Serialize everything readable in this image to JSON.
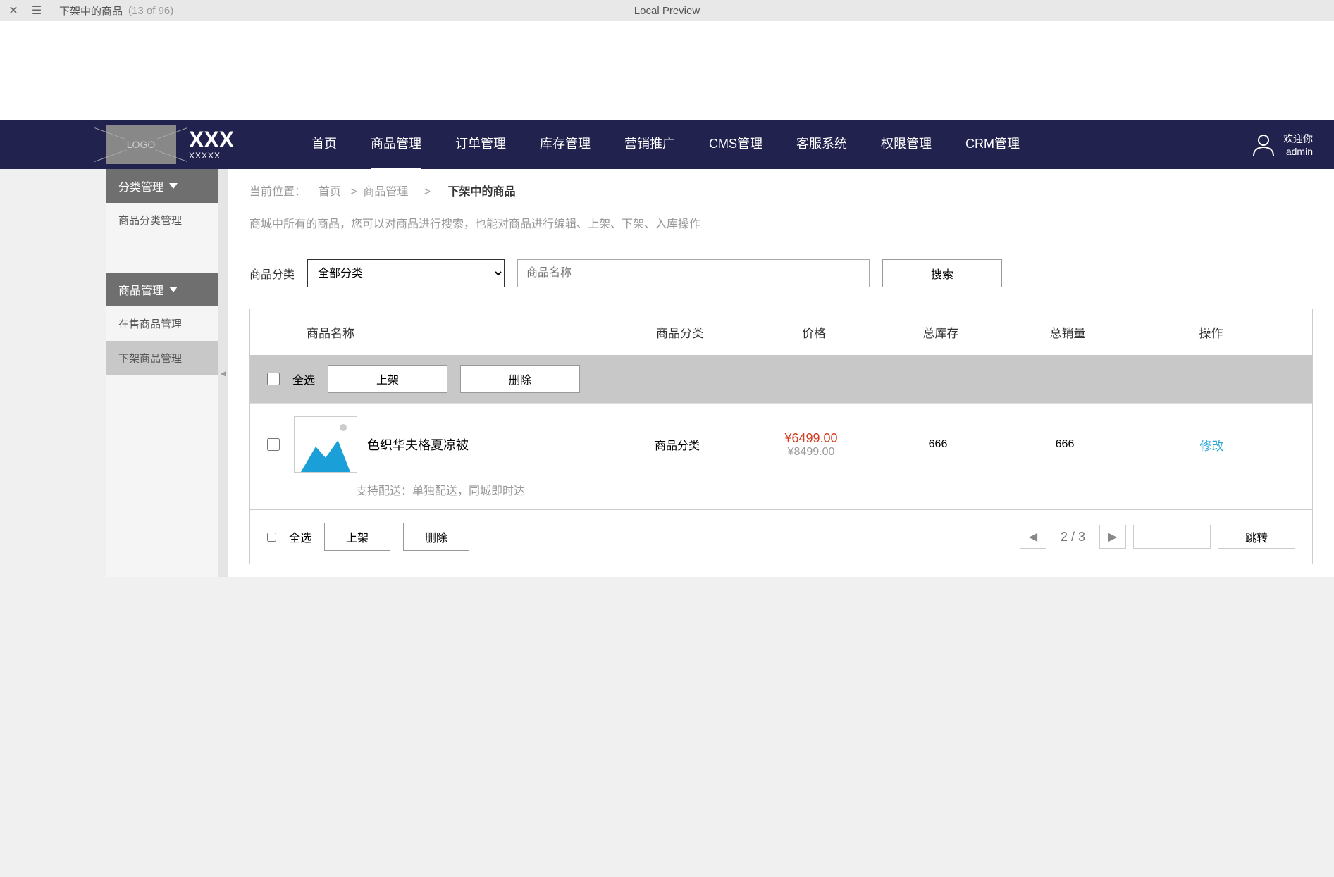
{
  "topbar": {
    "title": "下架中的商品",
    "count": "(13 of 96)",
    "preview": "Local Preview"
  },
  "header": {
    "logo": "LOGO",
    "brand": "XXX",
    "brand_sub": "XXXXX",
    "nav": [
      "首页",
      "商品管理",
      "订单管理",
      "库存管理",
      "营销推广",
      "CMS管理",
      "客服系统",
      "权限管理",
      "CRM管理"
    ],
    "active_nav_index": 1,
    "welcome": "欢迎你",
    "username": "admin"
  },
  "sidebar": {
    "group1": "分类管理",
    "group1_items": [
      "商品分类管理"
    ],
    "group2": "商品管理",
    "group2_items": [
      "在售商品管理",
      "下架商品管理"
    ],
    "group2_selected_index": 1
  },
  "breadcrumb": {
    "label": "当前位置：",
    "home": "首页",
    "sep1": ">",
    "level2": "商品管理",
    "sep2": ">",
    "current": "下架中的商品"
  },
  "desc": "商城中所有的商品，您可以对商品进行搜索，也能对商品进行编辑、上架、下架、入库操作",
  "filter": {
    "cat_label": "商品分类",
    "cat_value": "全部分类",
    "name_placeholder": "商品名称",
    "search_btn": "搜索"
  },
  "table": {
    "headers": {
      "name": "商品名称",
      "cat": "商品分类",
      "price": "价格",
      "stock": "总库存",
      "sales": "总销量",
      "op": "操作"
    },
    "select_all": "全选",
    "on_shelf": "上架",
    "delete": "删除",
    "row": {
      "name": "色织华夫格夏凉被",
      "cat": "商品分类",
      "price_now": "¥6499.00",
      "price_old": "¥8499.00",
      "stock": "666",
      "sales": "666",
      "edit": "修改",
      "delivery": "支持配送：单独配送，同城即时达"
    },
    "pager": {
      "text": "2 / 3",
      "jump": "跳转"
    }
  }
}
